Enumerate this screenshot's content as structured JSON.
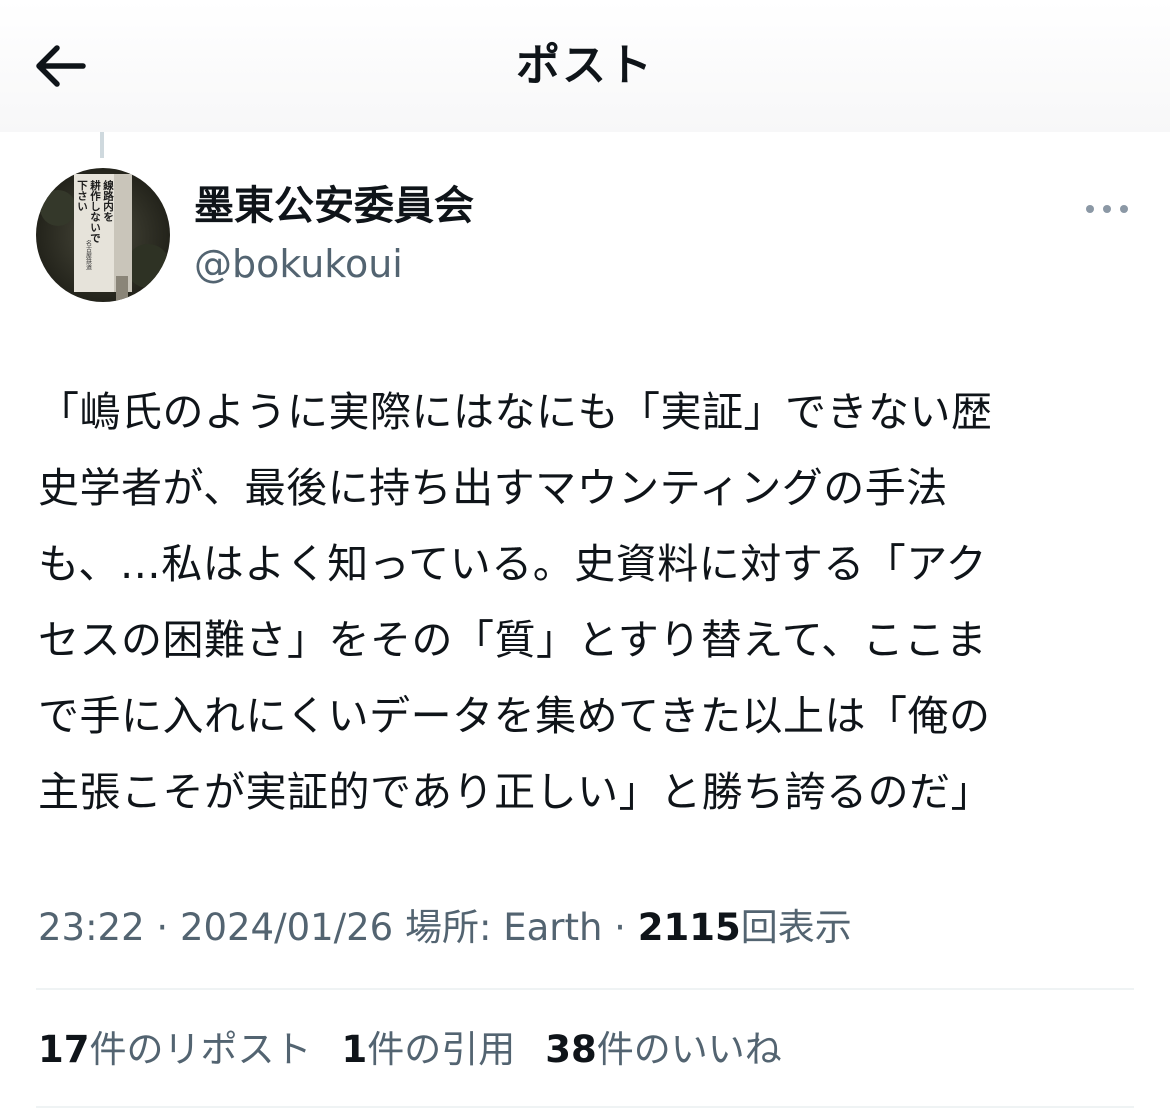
{
  "header": {
    "title": "ポスト"
  },
  "colors": {
    "text_primary": "#0f1419",
    "text_secondary": "#536471",
    "divider": "#eff3f4",
    "thread_line": "#cfd9de"
  },
  "icons": {
    "back": "back-arrow-icon",
    "more": "more-horizontal-icon"
  },
  "author": {
    "display_name": "墨東公安委員会",
    "handle": "@bokukoui",
    "avatar_sign_lines": [
      "線路内を",
      "耕作しないで",
      "下さい"
    ],
    "avatar_sign_footer": "名古屋鉄道"
  },
  "tweet": {
    "text": "「嶋氏のように実際にはなにも「実証」できない歴\n史学者が、最後に持ち出すマウンティングの手法\nも、…私はよく知っている。史資料に対する「アク\nセスの困難さ」をその「質」とすり替えて、ここま\nで手に入れにくいデータを集めてきた以上は「俺の\n主張こそが実証的であり正しい」と勝ち誇るのだ」"
  },
  "meta": {
    "time": "23:22",
    "date": "2024/01/26",
    "location_label": "場所: Earth",
    "views_count": "2115",
    "views_label": "回表示",
    "separator": " · "
  },
  "stats": [
    {
      "count": "17",
      "label": "件のリポスト"
    },
    {
      "count": "1",
      "label": "件の引用"
    },
    {
      "count": "38",
      "label": "件のいいね"
    }
  ]
}
